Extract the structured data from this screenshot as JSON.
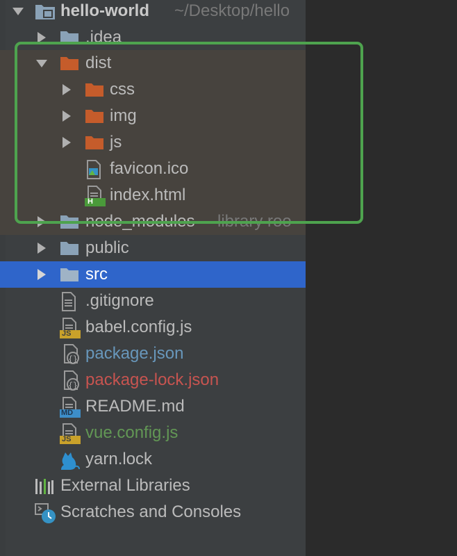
{
  "tree": {
    "root": {
      "name": "hello-world",
      "path": "~/Desktop/hello"
    },
    "items": [
      {
        "label": ".idea"
      },
      {
        "label": "dist"
      },
      {
        "label": "css"
      },
      {
        "label": "img"
      },
      {
        "label": "js"
      },
      {
        "label": "favicon.ico"
      },
      {
        "label": "index.html"
      },
      {
        "label": "node_modules",
        "suffix": "library roo"
      },
      {
        "label": "public"
      },
      {
        "label": "src"
      },
      {
        "label": ".gitignore"
      },
      {
        "label": "babel.config.js"
      },
      {
        "label": "package.json"
      },
      {
        "label": "package-lock.json"
      },
      {
        "label": "README.md"
      },
      {
        "label": "vue.config.js"
      },
      {
        "label": "yarn.lock"
      }
    ],
    "external_libraries": "External Libraries",
    "scratches": "Scratches and Consoles"
  },
  "badges": {
    "js": "JS",
    "md": "MD",
    "html": "H"
  },
  "colors": {
    "selection": "#2f65ca",
    "highlight_border": "#4ea34e",
    "folder_excluded": "#c55c2b",
    "folder_normal": "#8aa2b7",
    "file_modified": "#6897bb",
    "file_deleted": "#c75450",
    "file_added": "#629755"
  }
}
